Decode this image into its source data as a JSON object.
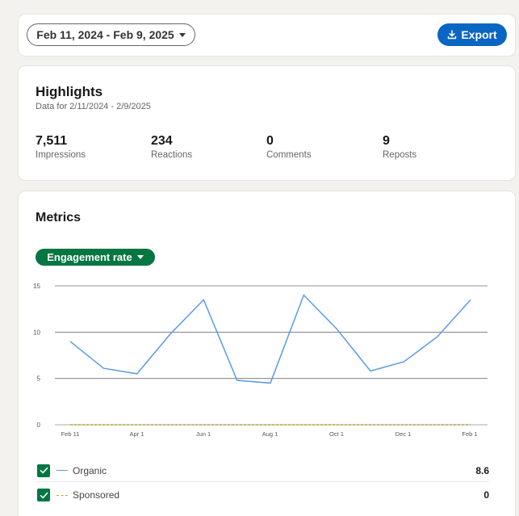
{
  "toolbar": {
    "date_range": "Feb 11, 2024 - Feb 9, 2025",
    "export_label": "Export"
  },
  "highlights": {
    "title": "Highlights",
    "subtitle": "Data for 2/11/2024 - 2/9/2025",
    "stats": [
      {
        "value": "7,511",
        "label": "Impressions"
      },
      {
        "value": "234",
        "label": "Reactions"
      },
      {
        "value": "0",
        "label": "Comments"
      },
      {
        "value": "9",
        "label": "Reposts"
      }
    ]
  },
  "metrics": {
    "title": "Metrics",
    "metric_selector": "Engagement rate",
    "legend": [
      {
        "name": "Organic",
        "value": "8.6",
        "checked": true,
        "color": "#5a9be6",
        "style": "solid"
      },
      {
        "name": "Sponsored",
        "value": "0",
        "checked": true,
        "color": "#b5a83a",
        "style": "dashed"
      }
    ]
  },
  "colors": {
    "accent_blue": "#0a66c2",
    "accent_green": "#057642",
    "organic_line": "#5a9be6",
    "sponsored_line": "#b5a83a"
  },
  "chart_data": {
    "type": "line",
    "x": [
      "2024-02-11",
      "2024-03-01",
      "2024-03-21",
      "2024-04-09",
      "2024-04-29",
      "2024-05-18",
      "2024-06-07",
      "2024-06-27",
      "2024-07-16",
      "2024-08-05",
      "2024-08-25",
      "2024-09-13",
      "2024-10-03",
      "2024-10-22",
      "2024-11-11",
      "2024-12-01",
      "2024-12-20",
      "2025-01-09",
      "2025-01-29"
    ],
    "x_ticks": [
      "Feb 11",
      "Apr 1",
      "Jun 1",
      "Aug 1",
      "Oct 1",
      "Dec 1",
      "Feb 1"
    ],
    "y_ticks": [
      0,
      5,
      10,
      15
    ],
    "ylim": [
      0,
      15
    ],
    "grid": true,
    "series": [
      {
        "name": "Organic",
        "values": [
          9.0,
          6.1,
          5.5,
          9.8,
          13.5,
          4.8,
          4.5,
          14.0,
          10.3,
          5.8,
          6.8,
          9.5,
          13.5
        ]
      },
      {
        "name": "Sponsored",
        "values": [
          0,
          0,
          0,
          0,
          0,
          0,
          0,
          0,
          0,
          0,
          0,
          0,
          0
        ]
      }
    ]
  }
}
